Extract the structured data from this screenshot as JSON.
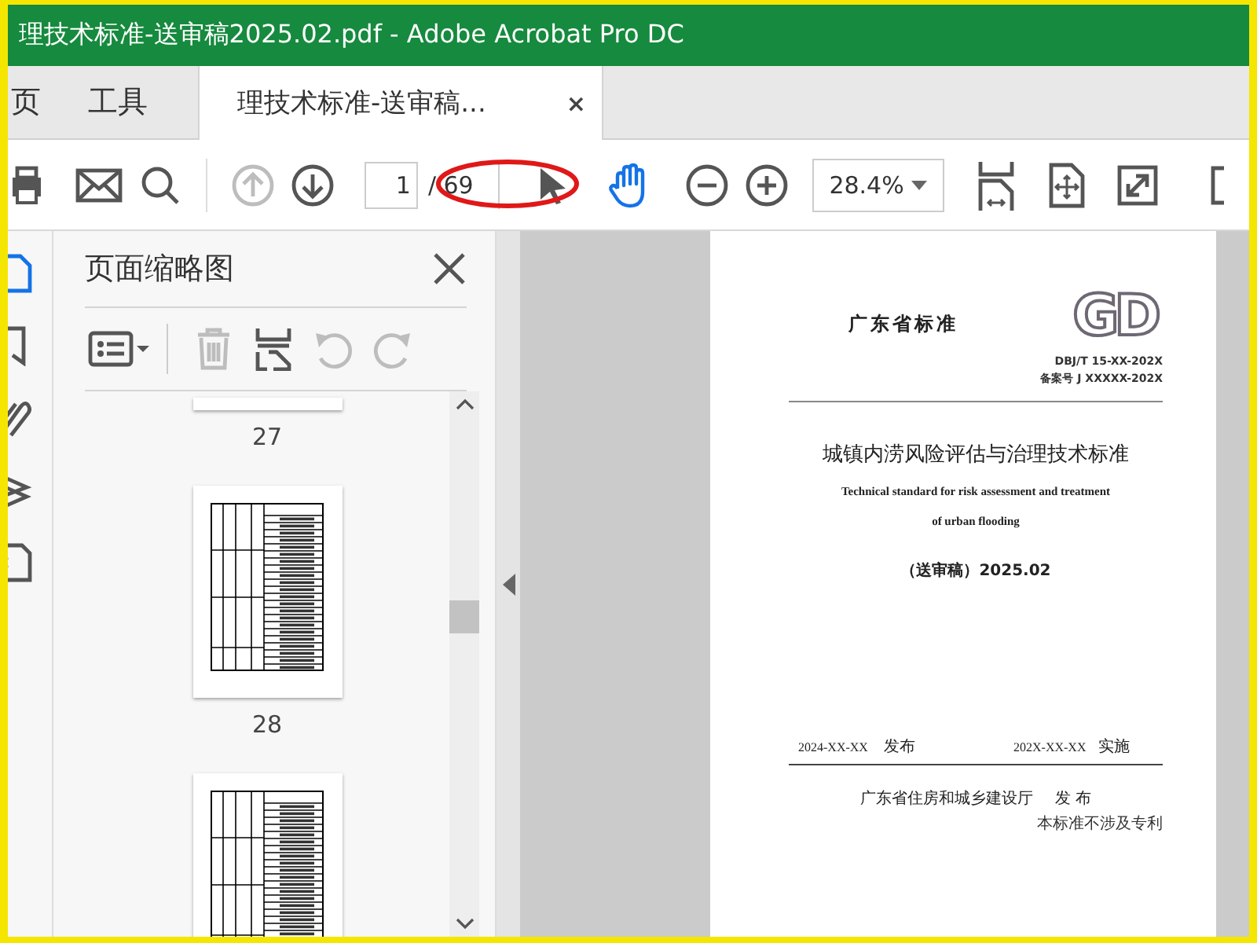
{
  "window": {
    "title": "理技术标准-送审稿2025.02.pdf - Adobe Acrobat Pro DC"
  },
  "nav_tabs": [
    {
      "label": "页",
      "selected": false
    },
    {
      "label": "工具",
      "selected": false
    }
  ],
  "document_tab": {
    "label": "理技术标准-送审稿...",
    "close": "×",
    "selected": true
  },
  "toolbar": {
    "file_tools": [
      {
        "kind": "print"
      },
      {
        "kind": "mail"
      },
      {
        "kind": "search"
      }
    ],
    "page_nav": [
      {
        "kind": "up",
        "disabled": true
      },
      {
        "kind": "down",
        "disabled": false
      }
    ],
    "page_input": {
      "value": "1"
    },
    "page_total": "/ 69",
    "modes": [
      {
        "kind": "select",
        "selected": false
      },
      {
        "kind": "hand",
        "selected": true
      }
    ],
    "zoom_tools": [
      {
        "kind": "zoom_out"
      },
      {
        "kind": "zoom_in"
      }
    ],
    "zoom": {
      "value": "28.4%"
    },
    "view_tools": [
      {
        "kind": "fit_width"
      },
      {
        "kind": "fit_page"
      },
      {
        "kind": "fullscreen"
      },
      {
        "kind": "more"
      }
    ]
  },
  "left_rail": [
    {
      "kind": "pages",
      "selected": true
    },
    {
      "kind": "bookmark",
      "selected": false
    },
    {
      "kind": "attachment",
      "selected": false
    },
    {
      "kind": "layers",
      "selected": false
    },
    {
      "kind": "document",
      "selected": false
    }
  ],
  "thumbnails_panel": {
    "title": "页面缩略图",
    "tools": [
      {
        "kind": "options",
        "disabled": false
      },
      {
        "kind": "delete",
        "disabled": true
      },
      {
        "kind": "insert",
        "disabled": false
      },
      {
        "kind": "rotate_ccw",
        "disabled": true
      },
      {
        "kind": "rotate_cw",
        "disabled": true
      }
    ],
    "thumbnails": [
      {
        "label": "27",
        "selected": false
      },
      {
        "label": "28",
        "selected": false
      },
      {
        "selected": false
      }
    ]
  },
  "page": {
    "header": "广东省标准",
    "logo_text": "GD",
    "code": "DBJ/T 15-XX-202X",
    "record": "备案号 J XXXXX-202X",
    "title": "城镇内涝风险评估与治理技术标准",
    "title_en": [
      "Technical standard for risk assessment and treatment",
      "of urban flooding"
    ],
    "draft": "（送审稿）2025.02",
    "publish_date": "2024-XX-XX",
    "publish_label": "发布",
    "implement_date": "202X-XX-XX",
    "implement_label": "实施",
    "issuer": "广东省住房和城乡建设厅",
    "issuer_label": "发 布",
    "note": "本标准不涉及专利"
  }
}
